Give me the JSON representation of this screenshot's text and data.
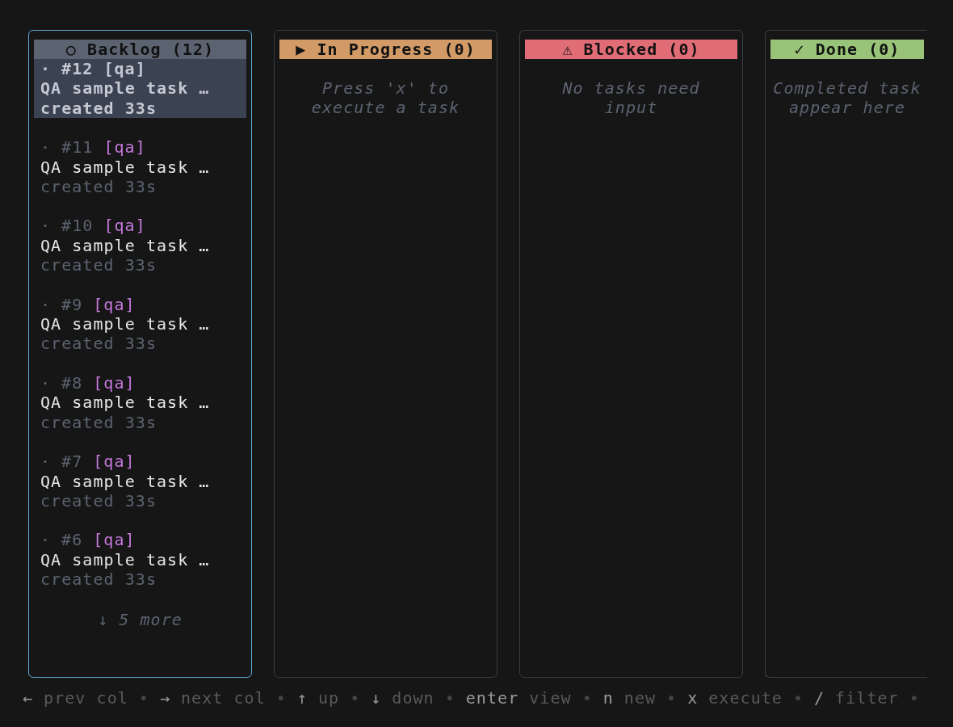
{
  "columns": [
    {
      "label": "○ Backlog (12)",
      "color": "#5c6370",
      "focused": true,
      "tasks": [
        {
          "marker": "·",
          "id": "#12",
          "tag": "[qa]",
          "title": "QA sample task …",
          "meta": "created 33s",
          "selected": true
        },
        {
          "marker": "·",
          "id": "#11",
          "tag": "[qa]",
          "title": "QA sample task …",
          "meta": "created 33s",
          "selected": false
        },
        {
          "marker": "·",
          "id": "#10",
          "tag": "[qa]",
          "title": "QA sample task …",
          "meta": "created 33s",
          "selected": false
        },
        {
          "marker": "·",
          "id": "#9",
          "tag": "[qa]",
          "title": "QA sample task …",
          "meta": "created 33s",
          "selected": false
        },
        {
          "marker": "·",
          "id": "#8",
          "tag": "[qa]",
          "title": "QA sample task …",
          "meta": "created 33s",
          "selected": false
        },
        {
          "marker": "·",
          "id": "#7",
          "tag": "[qa]",
          "title": "QA sample task …",
          "meta": "created 33s",
          "selected": false
        },
        {
          "marker": "·",
          "id": "#6",
          "tag": "[qa]",
          "title": "QA sample task …",
          "meta": "created 33s",
          "selected": false
        }
      ],
      "more": "↓ 5 more"
    },
    {
      "label": "▶ In Progress (0)",
      "color": "#d19a66",
      "focused": false,
      "empty_message": [
        "Press 'x' to",
        "execute a task"
      ]
    },
    {
      "label": "⚠ Blocked (0)",
      "color": "#e06c75",
      "focused": false,
      "empty_message": [
        "No tasks need",
        "input"
      ]
    },
    {
      "label": "✓ Done (0)",
      "color": "#98c379",
      "focused": false,
      "empty_message": [
        "Completed task",
        "appear here"
      ]
    }
  ],
  "footer": {
    "separator": "•",
    "hints": [
      {
        "key": "←",
        "action": "prev col"
      },
      {
        "key": "→",
        "action": "next col"
      },
      {
        "key": "↑",
        "action": "up"
      },
      {
        "key": "↓",
        "action": "down"
      },
      {
        "key": "enter",
        "action": "view"
      },
      {
        "key": "n",
        "action": "new"
      },
      {
        "key": "x",
        "action": "execute"
      },
      {
        "key": "/",
        "action": "filter"
      }
    ]
  }
}
